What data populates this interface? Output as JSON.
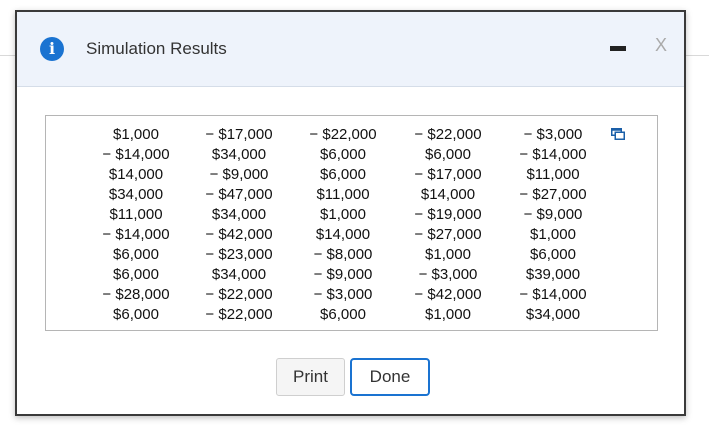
{
  "dialog": {
    "title": "Simulation Results",
    "minimize_label": "",
    "close_label": "X"
  },
  "results": {
    "columns": [
      [
        "$1,000",
        "− $14,000",
        "$14,000",
        "$34,000",
        "$11,000",
        "− $14,000",
        "$6,000",
        "$6,000",
        "− $28,000",
        "$6,000"
      ],
      [
        "− $17,000",
        "$34,000",
        "− $9,000",
        "− $47,000",
        "$34,000",
        "− $42,000",
        "− $23,000",
        "$34,000",
        "− $22,000",
        "− $22,000"
      ],
      [
        "− $22,000",
        "$6,000",
        "$6,000",
        "$11,000",
        "$1,000",
        "$14,000",
        "− $8,000",
        "− $9,000",
        "− $3,000",
        "$6,000"
      ],
      [
        "− $22,000",
        "$6,000",
        "− $17,000",
        "$14,000",
        "− $19,000",
        "− $27,000",
        "$1,000",
        "− $3,000",
        "− $42,000",
        "$1,000"
      ],
      [
        "− $3,000",
        "− $14,000",
        "$11,000",
        "− $27,000",
        "− $9,000",
        "$1,000",
        "$6,000",
        "$39,000",
        "− $14,000",
        "$34,000"
      ]
    ]
  },
  "buttons": {
    "print_label": "Print",
    "done_label": "Done"
  },
  "icons": {
    "info": "info-icon",
    "copy": "copy-to-clipboard-icon"
  },
  "colors": {
    "accent": "#1a73d1",
    "titlebar_bg": "#eef3fb"
  }
}
